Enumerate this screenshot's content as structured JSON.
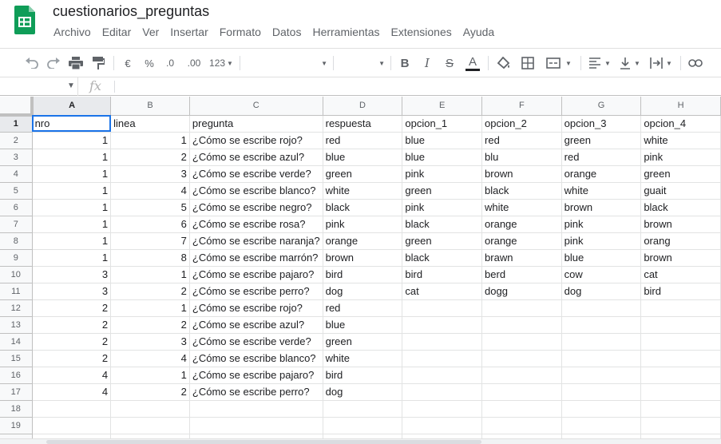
{
  "doc": {
    "title": "cuestionarios_preguntas",
    "logo_color": "#0f9d58"
  },
  "menu": [
    "Archivo",
    "Editar",
    "Ver",
    "Insertar",
    "Formato",
    "Datos",
    "Herramientas",
    "Extensiones",
    "Ayuda"
  ],
  "toolbar": {
    "undo_icon": "undo-icon",
    "redo_icon": "redo-icon",
    "print_icon": "print-icon",
    "paint_icon": "paint-format-icon",
    "currency": "€",
    "percent": "%",
    "dec_less": ".0",
    "dec_more": ".00",
    "more_formats": "123",
    "bold": "B",
    "italic": "I",
    "strike": "S",
    "text_color": "A"
  },
  "formula_bar": {
    "namebox": "",
    "fx": "fx",
    "content": ""
  },
  "sheet": {
    "columns": [
      "A",
      "B",
      "C",
      "D",
      "E",
      "F",
      "G",
      "H"
    ],
    "rows": [
      [
        "nro",
        "linea",
        "pregunta",
        "respuesta",
        "opcion_1",
        "opcion_2",
        "opcion_3",
        "opcion_4"
      ],
      [
        "1",
        "1",
        "¿Cómo se escribe rojo?",
        "red",
        "blue",
        "red",
        "green",
        "white"
      ],
      [
        "1",
        "2",
        "¿Cómo se escribe azul?",
        "blue",
        "blue",
        "blu",
        "red",
        "pink"
      ],
      [
        "1",
        "3",
        "¿Cómo se escribe verde?",
        "green",
        "pink",
        "brown",
        "orange",
        "green"
      ],
      [
        "1",
        "4",
        "¿Cómo se escribe blanco?",
        "white",
        "green",
        "black",
        "white",
        "guait"
      ],
      [
        "1",
        "5",
        "¿Cómo se escribe negro?",
        "black",
        "pink",
        "white",
        "brown",
        "black"
      ],
      [
        "1",
        "6",
        "¿Cómo se escribe rosa?",
        "pink",
        "black",
        "orange",
        "pink",
        "brown"
      ],
      [
        "1",
        "7",
        "¿Cómo se escribe naranja?",
        "orange",
        "green",
        "orange",
        "pink",
        "orang"
      ],
      [
        "1",
        "8",
        "¿Cómo se escribe marrón?",
        "brown",
        "black",
        "brawn",
        "blue",
        "brown"
      ],
      [
        "3",
        "1",
        "¿Cómo se escribe pajaro?",
        "bird",
        "bird",
        "berd",
        "cow",
        "cat"
      ],
      [
        "3",
        "2",
        "¿Cómo se escribe perro?",
        "dog",
        "cat",
        "dogg",
        "dog",
        "bird"
      ],
      [
        "2",
        "1",
        "¿Cómo se escribe rojo?",
        "red",
        "",
        "",
        "",
        ""
      ],
      [
        "2",
        "2",
        "¿Cómo se escribe azul?",
        "blue",
        "",
        "",
        "",
        ""
      ],
      [
        "2",
        "3",
        "¿Cómo se escribe verde?",
        "green",
        "",
        "",
        "",
        ""
      ],
      [
        "2",
        "4",
        "¿Cómo se escribe blanco?",
        "white",
        "",
        "",
        "",
        ""
      ],
      [
        "4",
        "1",
        "¿Cómo se escribe pajaro?",
        "bird",
        "",
        "",
        "",
        ""
      ],
      [
        "4",
        "2",
        "¿Cómo se escribe perro?",
        "dog",
        "",
        "",
        "",
        ""
      ],
      [
        "",
        "",
        "",
        "",
        "",
        "",
        "",
        ""
      ],
      [
        "",
        "",
        "",
        "",
        "",
        "",
        "",
        ""
      ],
      [
        "",
        "",
        "",
        "",
        "",
        "",
        "",
        ""
      ]
    ],
    "active_cell": "A1",
    "selection_color": "#1a73e8"
  }
}
